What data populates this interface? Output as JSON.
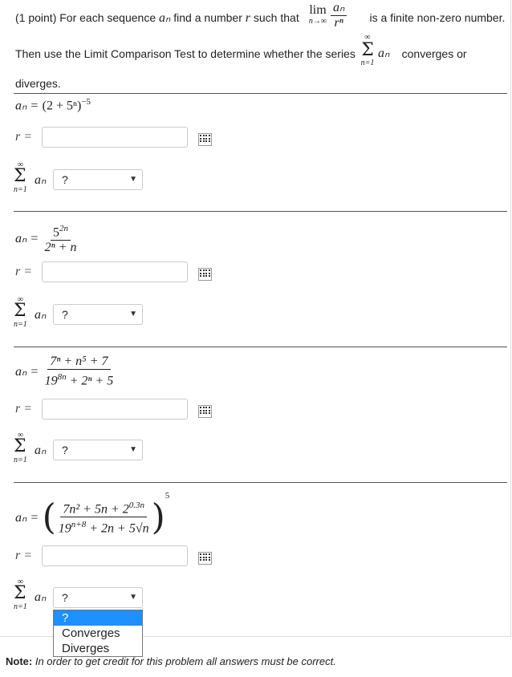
{
  "intro": {
    "points": "(1 point)",
    "line1_a": "For each sequence",
    "line1_b": "find a number",
    "line1_c": "such that",
    "line1_d": "is a finite non-zero number.",
    "line2_a": "Then use the Limit Comparison Test to determine whether the series",
    "line2_b": "converges or",
    "line3": "diverges.",
    "lim": "lim",
    "lim_sub": "n→∞",
    "frac_num": "aₙ",
    "frac_den": "rⁿ",
    "a_n": "aₙ",
    "r": "r",
    "sum_top": "∞",
    "sum_bot": "n=1"
  },
  "problems": [
    {
      "a_label": "aₙ =",
      "a_expr": "(2 + 5ⁿ)",
      "a_exp": "−5",
      "r_label": "r =",
      "r_value": "",
      "select_value": "?"
    },
    {
      "a_label": "aₙ =",
      "num": "5",
      "num_exp": "2n",
      "den": "2ⁿ + n",
      "r_label": "r =",
      "r_value": "",
      "select_value": "?"
    },
    {
      "a_label": "aₙ =",
      "num": "7ⁿ + n⁵ + 7",
      "den_base": "19",
      "den_exp": "8n",
      "den_rest": "+ 2ⁿ + 5",
      "r_label": "r =",
      "r_value": "",
      "select_value": "?"
    },
    {
      "a_label": "aₙ =",
      "num": "7n² + 5n + 2",
      "num_exp": "0.3n",
      "den_base": "19",
      "den_exp": "n+8",
      "den_rest": "+ 2n + 5√n",
      "outer_exp": "5",
      "r_label": "r =",
      "r_value": "",
      "select_value": "?"
    }
  ],
  "dropdown_options": [
    "?",
    "Converges",
    "Diverges"
  ],
  "sum": {
    "top": "∞",
    "sig": "Σ",
    "bot": "n=1",
    "term": "aₙ"
  },
  "note": {
    "label": "Note:",
    "text": "In order to get credit for this problem all answers must be correct."
  }
}
